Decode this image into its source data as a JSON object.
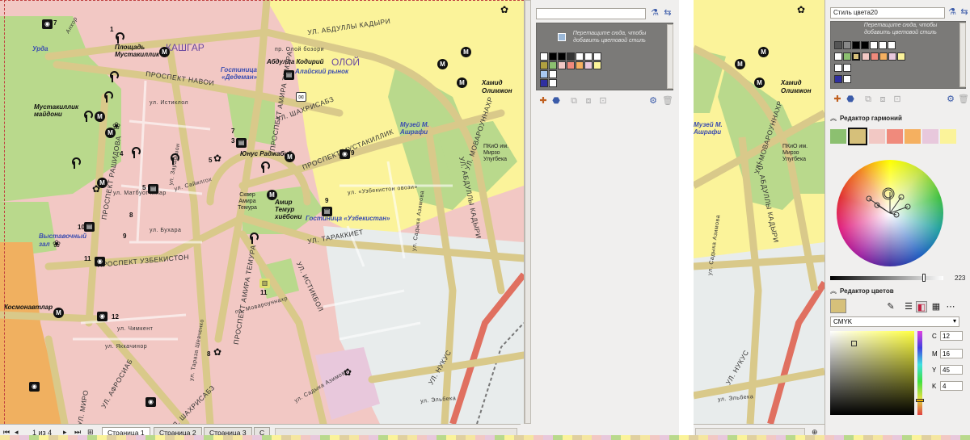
{
  "map": {
    "district_kashgar": "КАШГАР",
    "district_oloy": "ОЛОЙ",
    "streets": {
      "abdully_kadyri": "УЛ. АБДУЛЛЫ КАДЫРИ",
      "navoi": "ПРОСПЕКТ НАВОИ",
      "shakhrisabz": "УЛ. ШАХРИСАБЗ",
      "mustakillik": "ПРОСПЕКТ МУСТАКИЛЛИК",
      "movarounnakhr": "УЛ. МОВАРОУННАХР",
      "abdully_kadyri2": "УЛ. АБДУЛЛЫ КАДЫРИ",
      "amira_temura": "ПРОСПЕКТ АМИРА ТЕМУРА",
      "amira_temura2": "ПРОСПЕКТ АМИРА ТЕМУРА",
      "rashidova": "ПРОСПЕКТ РАШИДОВА",
      "uzbekiston": "ПРОСПЕКТ УЗБЕКИСТОН",
      "tarakkiet": "УЛ. ТАРАККИЕТ",
      "istiklol": "УЛ. ИСТИКБОЛ",
      "nukus": "УЛ. НУКУС",
      "shakhrisabz2": "УЛ. ШАХРИСАБЗ",
      "afrosiab": "УЛ. АФРОСИАБ",
      "mirobod": "УЛ. МИРО",
      "anhor": "Анхор",
      "istiklol_small": "ул. Истиклол",
      "mustakillik_small": "пр. Олой бозори",
      "uzbekiston_ovozi": "ул. «Узбекистон овози»",
      "sayilgokh": "ул. Сайилгох",
      "matbuotchilar": "ул. Матбуотчилар",
      "bukhara": "ул. Бухара",
      "chimkent": "ул. Чимкент",
      "yakkachinor": "ул. Яккачинор",
      "movarounnakhr_pr": "пр. Мовароуннахр",
      "sadyka_azimova": "ул. Садыка Азимова",
      "sadyka_azimova2": "ул. Садыка Азимова",
      "elbeka": "ул. Эльбека",
      "taraza": "ул. Тараза Шевченко",
      "zarafshon": "ул. Зарафшон"
    },
    "pois": {
      "ploshchad_mustakillik": "Площадь Мустакиллик",
      "mustakillik_maydoni": "Мустакиллик майдони",
      "dedeman": "Гостиница «Дедеман»",
      "abdulla_kodiriy": "Абдулла Кодирий",
      "alay_bazaar": "Алайский рынок",
      "khamid_olimzhon": "Хамид Олимжон",
      "yunus_radzhabiy": "Юнус Раджабий",
      "museum_ashrafi": "Музей М. Ашрафи",
      "pkio": "ПКиО им. Мирзо Улугбека",
      "skver": "Сквер Амира Темура",
      "amir_temur_khiyoboni": "Амир Темур хиёбони",
      "hotel_uzbekistan": "Гостиница «Узбекистан»",
      "vystavochny_zal": "Выставочный зал",
      "kosmonavtlar": "Космонавтлар",
      "urda": "Урда"
    }
  },
  "right_map": {
    "khamid_olimzhon": "Хамид Олимжон",
    "museum_ashrafi": "Музей М. Ашрафи",
    "pkio": "ПКиО им. Мирзо Улугбека",
    "movarounnakhr": "УЛ. МОВАРОУННАХР",
    "abdully_kadyri": "УЛ. АБДУЛЛЫ КАДЫРИ",
    "sadyka_azimova": "ул. Садыка Азимова",
    "nukus": "УЛ. НУКУС",
    "elbeka": "ул. Эльбека"
  },
  "docker_left": {
    "drop_hint": "Перетащите сюда, чтобы добавить цветовой стиль"
  },
  "docker_right": {
    "style_name": "Стиль цвета20",
    "drop_hint": "Перетащите сюда, чтобы добавить цветовой стиль",
    "harmony_editor": "Редактор гармоний",
    "color_editor": "Редактор цветов",
    "slider_value": "223",
    "color_model": "CMYK",
    "cmyk": [
      {
        "label": "C",
        "value": "12"
      },
      {
        "label": "M",
        "value": "16"
      },
      {
        "label": "Y",
        "value": "45"
      },
      {
        "label": "K",
        "value": "4"
      }
    ]
  },
  "status": {
    "page_counter": "1 из 4",
    "tabs": [
      "Страница 1",
      "Страница 2",
      "Страница 3",
      "С"
    ]
  },
  "colors": {
    "pink_block": "#f2c8c4",
    "green_park": "#b9d98c",
    "yellow_area": "#fbf39a",
    "road": "#d9c98a",
    "mauve": "#e8c8dc",
    "docker_bg": "#f0efee",
    "palette_bg": "#7b7a78",
    "swatch_selected": "#d6c07a"
  }
}
